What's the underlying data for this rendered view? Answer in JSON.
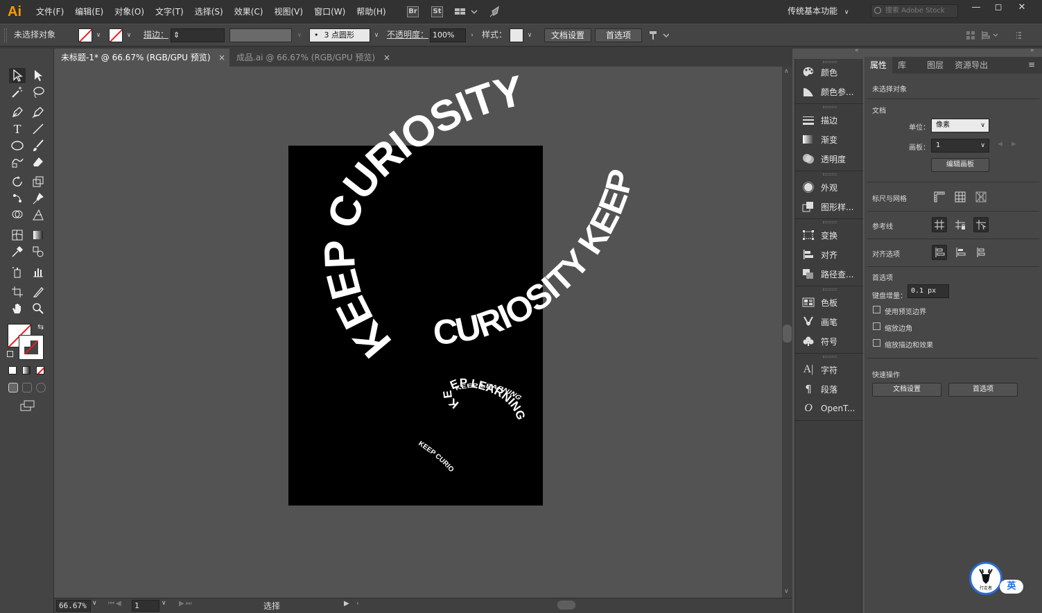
{
  "app": {
    "logo": "Ai",
    "accent": "#ff9a00",
    "workspace": "传统基本功能",
    "search_placeholder": "搜索 Adobe Stock"
  },
  "menu": [
    "文件(F)",
    "编辑(E)",
    "对象(O)",
    "文字(T)",
    "选择(S)",
    "效果(C)",
    "视图(V)",
    "窗口(W)",
    "帮助(H)"
  ],
  "bridge_buttons": {
    "br": "Br",
    "st": "St"
  },
  "window_controls": {
    "minimize": "—",
    "restore": "◻",
    "close": "✕"
  },
  "control_bar": {
    "no_selection": "未选择对象",
    "stroke_label": "描边：",
    "brush": "3 点圆形",
    "opacity_label": "不透明度：",
    "opacity_value": "100%",
    "style_label": "样式：",
    "doc_setup": "文档设置",
    "preferences": "首选项"
  },
  "tabs": [
    {
      "label": "未标题-1* @ 66.67% (RGB/GPU 预览)",
      "active": true
    },
    {
      "label": "成品.ai @ 66.67% (RGB/GPU 预览)",
      "active": false
    }
  ],
  "tab_close": "×",
  "artwork": {
    "big_outer": "KEEP CURIOSITY",
    "big_inner": "CURIOSITY KEEP",
    "mid_top": "KEEP LEARNING",
    "mid_bottom": "KEEP LEARNING",
    "small": "KEEP CURIOSITY"
  },
  "status": {
    "zoom": "66.67%",
    "artboard": "1",
    "tool": "选择"
  },
  "icon_panel": [
    {
      "label": "颜色",
      "icon": "palette-icon"
    },
    {
      "label": "颜色参...",
      "icon": "color-guide-icon"
    },
    {
      "label": "描边",
      "icon": "stroke-icon"
    },
    {
      "label": "渐变",
      "icon": "gradient-icon"
    },
    {
      "label": "透明度",
      "icon": "transparency-icon"
    },
    {
      "label": "外观",
      "icon": "appearance-icon"
    },
    {
      "label": "图形样...",
      "icon": "graphic-styles-icon"
    },
    {
      "label": "变换",
      "icon": "transform-icon"
    },
    {
      "label": "对齐",
      "icon": "align-icon"
    },
    {
      "label": "路径查...",
      "icon": "pathfinder-icon"
    },
    {
      "label": "色板",
      "icon": "swatches-icon"
    },
    {
      "label": "画笔",
      "icon": "brushes-icon"
    },
    {
      "label": "符号",
      "icon": "symbols-icon"
    },
    {
      "label": "字符",
      "icon": "character-icon"
    },
    {
      "label": "段落",
      "icon": "paragraph-icon"
    },
    {
      "label": "OpenT...",
      "icon": "opentype-icon"
    }
  ],
  "props": {
    "tabs": [
      "属性",
      "库",
      "图层",
      "资源导出"
    ],
    "no_selection": "未选择对象",
    "document": "文档",
    "units_label": "单位：",
    "units_value": "像素",
    "artboard_label": "画板：",
    "artboard_value": "1",
    "edit_artboards": "编辑画板",
    "rulers_grids": "标尺与网格",
    "guides": "参考线",
    "align_options": "对齐选项",
    "preferences": "首选项",
    "keyboard_increment_label": "键盘增量：",
    "keyboard_increment_value": "0.1 px",
    "use_preview_bounds": "使用预览边界",
    "scale_corners": "缩放边角",
    "scale_strokes_effects": "缩放描边和效果",
    "quick_actions": "快速操作",
    "doc_setup": "文档设置",
    "prefs_button": "首选项"
  },
  "ime": {
    "logo_text": "行走者",
    "badge": "英"
  }
}
